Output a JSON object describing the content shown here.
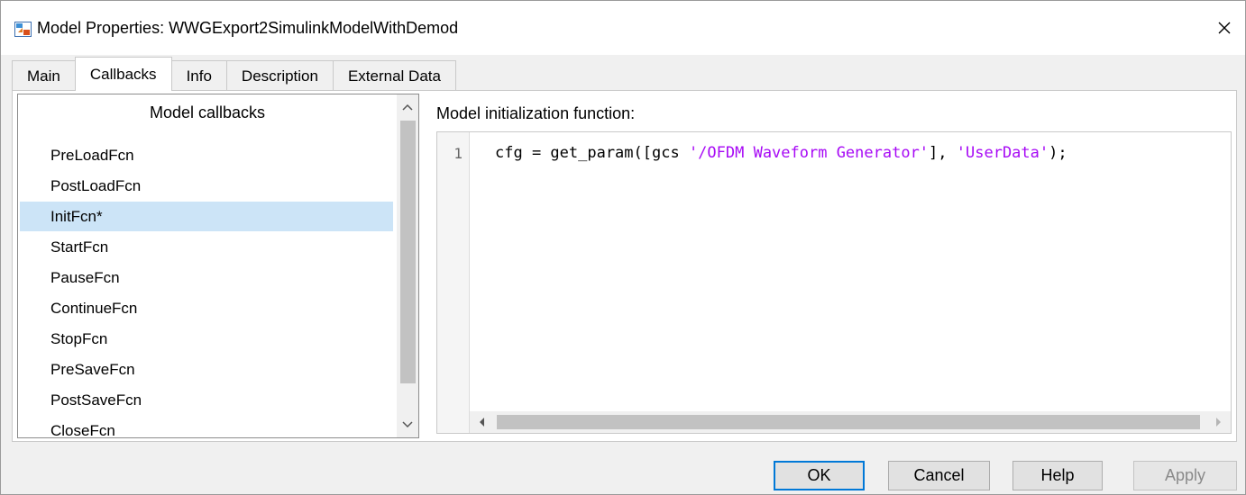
{
  "window": {
    "title": "Model Properties: WWGExport2SimulinkModelWithDemod",
    "app_icon": "simulink-model-icon",
    "close_glyph": "✕"
  },
  "tabs": [
    {
      "label": "Main",
      "active": false
    },
    {
      "label": "Callbacks",
      "active": true
    },
    {
      "label": "Info",
      "active": false
    },
    {
      "label": "Description",
      "active": false
    },
    {
      "label": "External Data",
      "active": false
    }
  ],
  "callbacks": {
    "header": "Model callbacks",
    "items": [
      {
        "label": "PreLoadFcn",
        "selected": false
      },
      {
        "label": "PostLoadFcn",
        "selected": false
      },
      {
        "label": "InitFcn*",
        "selected": true
      },
      {
        "label": "StartFcn",
        "selected": false
      },
      {
        "label": "PauseFcn",
        "selected": false
      },
      {
        "label": "ContinueFcn",
        "selected": false
      },
      {
        "label": "StopFcn",
        "selected": false
      },
      {
        "label": "PreSaveFcn",
        "selected": false
      },
      {
        "label": "PostSaveFcn",
        "selected": false
      },
      {
        "label": "CloseFcn",
        "selected": false
      }
    ]
  },
  "editor": {
    "label": "Model initialization function:",
    "line_number": "1",
    "code": {
      "prefix": "cfg = get_param([gcs ",
      "string1": "'/OFDM Waveform Generator'",
      "middle": "], ",
      "string2": "'UserData'",
      "suffix": ");"
    },
    "string_color": "#a709f5"
  },
  "buttons": {
    "ok": "OK",
    "cancel": "Cancel",
    "help": "Help",
    "apply": "Apply"
  },
  "colors": {
    "selection": "#cce4f7",
    "default_button_border": "#0078d7"
  }
}
